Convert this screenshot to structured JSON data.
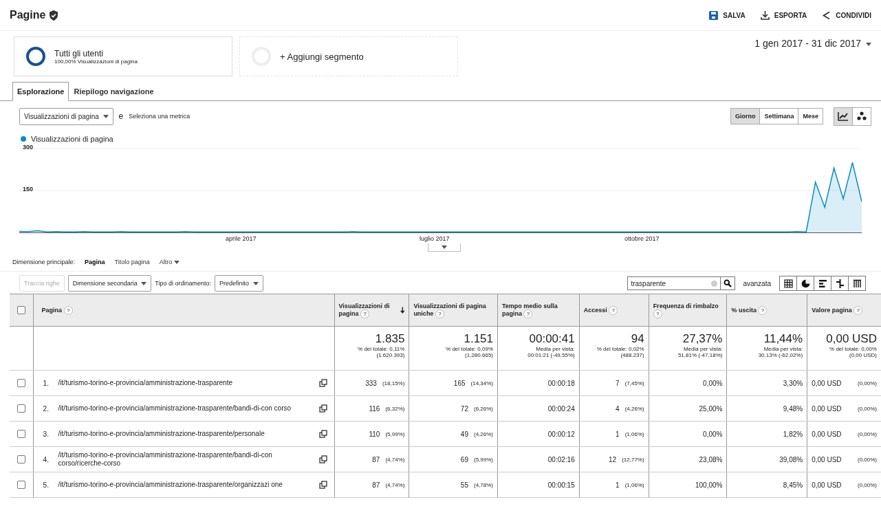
{
  "header": {
    "title": "Pagine",
    "actions": [
      "SALVA",
      "ESPORTA",
      "CONDIVIDI"
    ]
  },
  "segments": [
    {
      "name": "Tutti gli utenti",
      "detail": "100,00% Visualizzazioni di pagina"
    }
  ],
  "add_segment": "+ Aggiungi segmento",
  "date_range": "1 gen 2017 - 31 dic 2017",
  "tabs": [
    {
      "label": "Esplorazione",
      "selected": true
    },
    {
      "label": "Riepilogo navigazione",
      "selected": false
    }
  ],
  "metric_select": "Visualizzazioni di pagina",
  "metric_connector": "e",
  "secondary_metric": "Seleziona una metrica",
  "periods": [
    {
      "label": "Giorno",
      "selected": true
    },
    {
      "label": "Settimana",
      "selected": false
    },
    {
      "label": "Mese",
      "selected": false
    }
  ],
  "chart": {
    "x_labels": [
      "aprile 2017",
      "luglio 2017",
      "ottobre 2017"
    ],
    "chart_data": {
      "type": "area",
      "ylim": [
        0,
        300
      ],
      "yticks": [
        150,
        300
      ],
      "series": [
        {
          "name": "Visualizzazioni di pagina",
          "color": "#058dc7",
          "values": [
            4,
            3,
            6,
            2,
            3,
            2,
            2,
            3,
            2,
            2,
            2,
            3,
            2,
            2,
            2,
            2,
            2,
            2,
            3,
            2,
            2,
            2,
            2,
            2,
            2,
            2,
            2,
            2,
            2,
            2,
            2,
            2,
            2,
            2,
            2,
            2,
            3,
            2,
            2,
            2,
            2,
            2,
            2,
            2,
            2,
            2,
            2,
            2,
            2,
            2,
            2,
            2,
            2,
            2,
            2,
            2,
            2,
            2,
            2,
            2,
            2,
            2,
            2,
            2,
            2,
            2,
            2,
            2,
            2,
            2,
            2,
            2,
            2,
            2,
            2,
            2,
            2,
            2,
            2,
            2,
            2,
            2,
            2,
            2,
            3,
            2,
            180,
            90,
            230,
            120,
            250,
            110
          ]
        }
      ]
    }
  },
  "dimension": {
    "label": "Dimensione principale:",
    "options": [
      {
        "label": "Pagina",
        "selected": true
      },
      {
        "label": "Titolo pagina",
        "selected": false
      },
      {
        "label": "Altro",
        "selected": false
      }
    ]
  },
  "toolbar": {
    "plot_rows": {
      "label": "Traccia righe",
      "disabled": true
    },
    "secondary_dimension": "Dimensione secondaria",
    "sort_label": "Tipo di ordinamento:",
    "sort_value": "Predefinito",
    "search_value": "trasparente",
    "advanced": "avanzata"
  },
  "table": {
    "all_checked": false,
    "columns": [
      {
        "label": "Pagina",
        "help": "?",
        "sorted": false
      },
      {
        "label": "Visualizzazioni di pagina",
        "help": "?",
        "sorted": true
      },
      {
        "label": "Visualizzazioni di pagina uniche",
        "help": "?",
        "sorted": false
      },
      {
        "label": "Tempo medio sulla pagina",
        "help": "?",
        "sorted": false
      },
      {
        "label": "Accessi",
        "help": "?",
        "sorted": false
      },
      {
        "label": "Frequenza di rimbalzo",
        "help": "?",
        "sorted": false
      },
      {
        "label": "% uscita",
        "help": "?",
        "sorted": false
      },
      {
        "label": "Valore pagina",
        "help": "?",
        "sorted": false
      }
    ],
    "totals": [
      {
        "value": "1.835",
        "sub": [
          "% del totale: 0,11%",
          "(1.620.393)"
        ]
      },
      {
        "value": "1.151",
        "sub": [
          "% del totale: 0,09%",
          "(1.280.665)"
        ]
      },
      {
        "value": "00:00:41",
        "sub": [
          "Media per vista:",
          "00:01:21 (-49,55%)"
        ]
      },
      {
        "value": "94",
        "sub": [
          "% del totale: 0,02%",
          "(488.237)"
        ]
      },
      {
        "value": "27,37%",
        "sub": [
          "Media per vista:",
          "51,81% (-47,18%)"
        ]
      },
      {
        "value": "11,44%",
        "sub": [
          "Media per vista:",
          "30,13% (-62,02%)"
        ]
      },
      {
        "value": "0,00 USD",
        "sub": [
          "% del totale: 0,00%",
          "(0,00 USD)"
        ]
      }
    ],
    "rows": [
      {
        "checked": false,
        "index": "1.",
        "cells": [
          {
            "value": "/it/turismo-torino-e-provincia/amministrazione-trasparente"
          },
          {
            "value": "333",
            "pct": "(18,15%)"
          },
          {
            "value": "165",
            "pct": "(14,34%)"
          },
          {
            "value": "00:00:18"
          },
          {
            "value": "7",
            "pct": "(7,45%)"
          },
          {
            "value": "0,00%"
          },
          {
            "value": "3,30%"
          },
          {
            "value": "0,00 USD",
            "pct": "(0,00%)"
          }
        ]
      },
      {
        "checked": false,
        "index": "2.",
        "cells": [
          {
            "value": "/it/turismo-torino-e-provincia/amministrazione-trasparente/bandi-di-con corso"
          },
          {
            "value": "116",
            "pct": "(6,32%)"
          },
          {
            "value": "72",
            "pct": "(6,26%)"
          },
          {
            "value": "00:00:24"
          },
          {
            "value": "4",
            "pct": "(4,26%)"
          },
          {
            "value": "25,00%"
          },
          {
            "value": "9,48%"
          },
          {
            "value": "0,00 USD",
            "pct": "(0,00%)"
          }
        ]
      },
      {
        "checked": false,
        "index": "3.",
        "cells": [
          {
            "value": "/it/turismo-torino-e-provincia/amministrazione-trasparente/personale"
          },
          {
            "value": "110",
            "pct": "(5,99%)"
          },
          {
            "value": "49",
            "pct": "(4,26%)"
          },
          {
            "value": "00:00:12"
          },
          {
            "value": "1",
            "pct": "(1,06%)"
          },
          {
            "value": "0,00%"
          },
          {
            "value": "1,82%"
          },
          {
            "value": "0,00 USD",
            "pct": "(0,00%)"
          }
        ]
      },
      {
        "checked": false,
        "index": "4.",
        "cells": [
          {
            "value": "/it/turismo-torino-e-provincia/amministrazione-trasparente/bandi-di-con corso/ricerche-corso"
          },
          {
            "value": "87",
            "pct": "(4,74%)"
          },
          {
            "value": "69",
            "pct": "(5,99%)"
          },
          {
            "value": "00:02:16"
          },
          {
            "value": "12",
            "pct": "(12,77%)"
          },
          {
            "value": "23,08%"
          },
          {
            "value": "39,08%"
          },
          {
            "value": "0,00 USD",
            "pct": "(0,00%)"
          }
        ]
      },
      {
        "checked": false,
        "index": "5.",
        "cells": [
          {
            "value": "/it/turismo-torino-e-provincia/amministrazione-trasparente/organizzazi one"
          },
          {
            "value": "87",
            "pct": "(4,74%)"
          },
          {
            "value": "55",
            "pct": "(4,78%)"
          },
          {
            "value": "00:00:15"
          },
          {
            "value": "1",
            "pct": "(1,06%)"
          },
          {
            "value": "100,00%"
          },
          {
            "value": "8,45%"
          },
          {
            "value": "0,00 USD",
            "pct": "(0,00%)"
          }
        ]
      }
    ]
  }
}
